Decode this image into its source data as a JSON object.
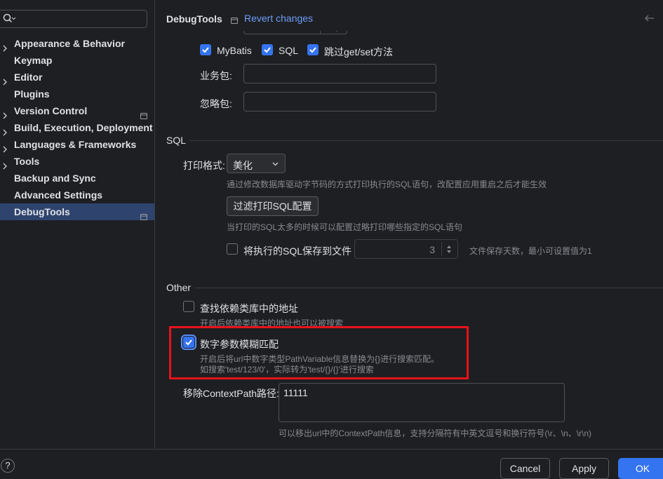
{
  "sidebar": {
    "search_placeholder": "",
    "items": [
      {
        "label": "Appearance & Behavior",
        "expandable": true
      },
      {
        "label": "Keymap",
        "expandable": false
      },
      {
        "label": "Editor",
        "expandable": true
      },
      {
        "label": "Plugins",
        "expandable": false
      },
      {
        "label": "Version Control",
        "expandable": true
      },
      {
        "label": "Build, Execution, Deployment",
        "expandable": true
      },
      {
        "label": "Languages & Frameworks",
        "expandable": true
      },
      {
        "label": "Tools",
        "expandable": true
      },
      {
        "label": "Backup and Sync",
        "expandable": false
      },
      {
        "label": "Advanced Settings",
        "expandable": false
      },
      {
        "label": "DebugTools",
        "expandable": false,
        "selected": true
      }
    ]
  },
  "header": {
    "title": "DebugTools",
    "revert_label": "Revert changes"
  },
  "scan": {
    "mybatis_label": "MyBatis",
    "mybatis_checked": true,
    "sql_label": "SQL",
    "sql_checked": true,
    "skip_getset_label": "跳过get/set方法",
    "skip_getset_checked": true,
    "business_pkg_label": "业务包:",
    "business_pkg_value": "",
    "ignore_pkg_label": "忽略包:",
    "ignore_pkg_value": ""
  },
  "sql_section": {
    "title": "SQL",
    "print_format_label": "打印格式:",
    "print_format_value": "美化",
    "print_format_hint": "通过修改数据库驱动字节码的方式打印执行的SQL语句，改配置应用重启之后才能生效",
    "filter_button": "过滤打印SQL配置",
    "filter_hint": "当打印的SQL太多的时候可以配置过略打印哪些指定的SQL语句",
    "save_to_file_label": "将执行的SQL保存到文件",
    "save_to_file_checked": false,
    "save_days_value": "3",
    "save_days_hint": "文件保存天数，最小可设置值为1"
  },
  "other_section": {
    "title": "Other",
    "find_dep_label": "查找依赖类库中的地址",
    "find_dep_checked": false,
    "find_dep_hint": "开启后依赖类库中的地址也可以被搜索",
    "fuzzy_label": "数字参数模糊匹配",
    "fuzzy_checked": true,
    "fuzzy_hint_1": "开启后将url中数字类型PathVariable信息替换为{}进行搜索匹配。",
    "fuzzy_hint_2": "如搜索'test/123/0'，实际转为'test/{}/{}'进行搜索",
    "context_path_label": "移除ContextPath路径:",
    "context_path_value": "11111",
    "context_path_hint": "可以移出url中的ContextPath信息，支持分隔符有中英文逗号和换行符号(\\r、\\n、\\r\\n)"
  },
  "footer": {
    "help_label": "?",
    "cancel_label": "Cancel",
    "apply_label": "Apply",
    "ok_label": "OK"
  },
  "colors": {
    "accent": "#3574f0",
    "link": "#6e9dfa",
    "selection": "#2e436e",
    "highlight_box": "#e8121b"
  }
}
